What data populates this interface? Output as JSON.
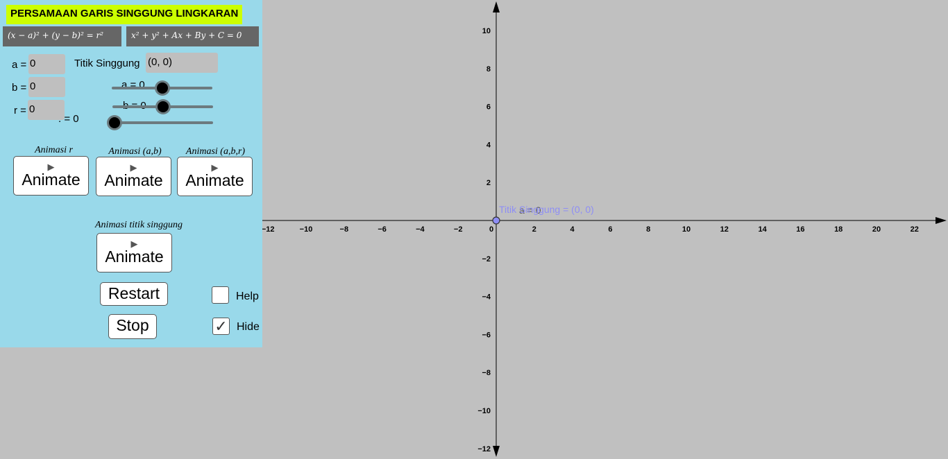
{
  "panel": {
    "title": "PERSAMAAN GARIS SINGGUNG LINGKARAN",
    "formula_1": "(x − a)² + (y − b)² = r²",
    "formula_2": "x² + y² + Ax + By + C = 0",
    "a_label": "a =",
    "a_value": "0",
    "b_label": "b =",
    "b_value": "0",
    "r_label": "r =",
    "r_value": "0",
    "tangent_label": "Titik Singgung",
    "tangent_value": "(0, 0)",
    "slider_a_label": "a = 0",
    "slider_a_value": 0,
    "slider_b_label": "b = 0",
    "slider_b_value": 0,
    "slider_3_label": ". = 0",
    "slider_3_value": 0,
    "anim_r_label": "Animasi r",
    "anim_ab_label": "Animasi (a,b)",
    "anim_abr_label": "Animasi (a,b,r)",
    "anim_tangent_label": "Animasi titik singgung",
    "animate_label": "Animate",
    "restart_label": "Restart",
    "stop_label": "Stop",
    "help_label": "Help",
    "help_checked": false,
    "hide_label": "Hide",
    "hide_checked": true,
    "checkmark": "✓",
    "play_glyph": "▶"
  },
  "graph": {
    "x_ticks": [
      "−12",
      "−10",
      "−8",
      "−6",
      "−4",
      "−2",
      "0",
      "2",
      "4",
      "6",
      "8",
      "10",
      "12",
      "14",
      "16",
      "18",
      "20",
      "22"
    ],
    "y_ticks_pos": [
      "2",
      "4",
      "6",
      "8",
      "10"
    ],
    "y_ticks_neg": [
      "−2",
      "−4",
      "−6",
      "−8",
      "−10",
      "−12"
    ],
    "point_label": "Titik Singgung = (0, 0)",
    "overlap_label": "a = 0",
    "point_color": "#8e8ef5",
    "background": "#c0c0c0"
  }
}
